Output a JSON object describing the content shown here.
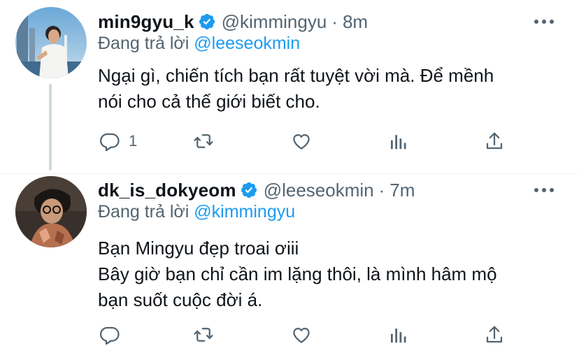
{
  "colors": {
    "accent": "#1d9bf0",
    "secondary_text": "#536471",
    "primary_text": "#0f1419",
    "verified_badge": "#1d9bf0"
  },
  "tweets": [
    {
      "display_name": "min9gyu_k",
      "verified": true,
      "handle": "@kimmingyu",
      "separator": "·",
      "time": "8m",
      "replying_prefix": "Đang trả lời",
      "replying_to": "@leeseokmin",
      "body_lines": [
        "Ngại gì, chiến tích bạn rất tuyệt vời mà. Để mềnh",
        "nói cho cả thế giới biết cho."
      ],
      "reply_count": "1",
      "icons": [
        "reply-icon",
        "retweet-icon",
        "like-icon",
        "analytics-icon",
        "share-icon"
      ]
    },
    {
      "display_name": "dk_is_dokyeom",
      "verified": true,
      "handle": "@leeseokmin",
      "separator": "·",
      "time": "7m",
      "replying_prefix": "Đang trả lời",
      "replying_to": "@kimmingyu",
      "body_lines": [
        "Bạn Mingyu đẹp troai ơiii",
        "Bây giờ bạn chỉ cần im lặng thôi, là mình hâm mộ",
        "bạn suốt cuộc đời á."
      ],
      "reply_count": "",
      "icons": [
        "reply-icon",
        "retweet-icon",
        "like-icon",
        "analytics-icon",
        "share-icon"
      ]
    }
  ]
}
